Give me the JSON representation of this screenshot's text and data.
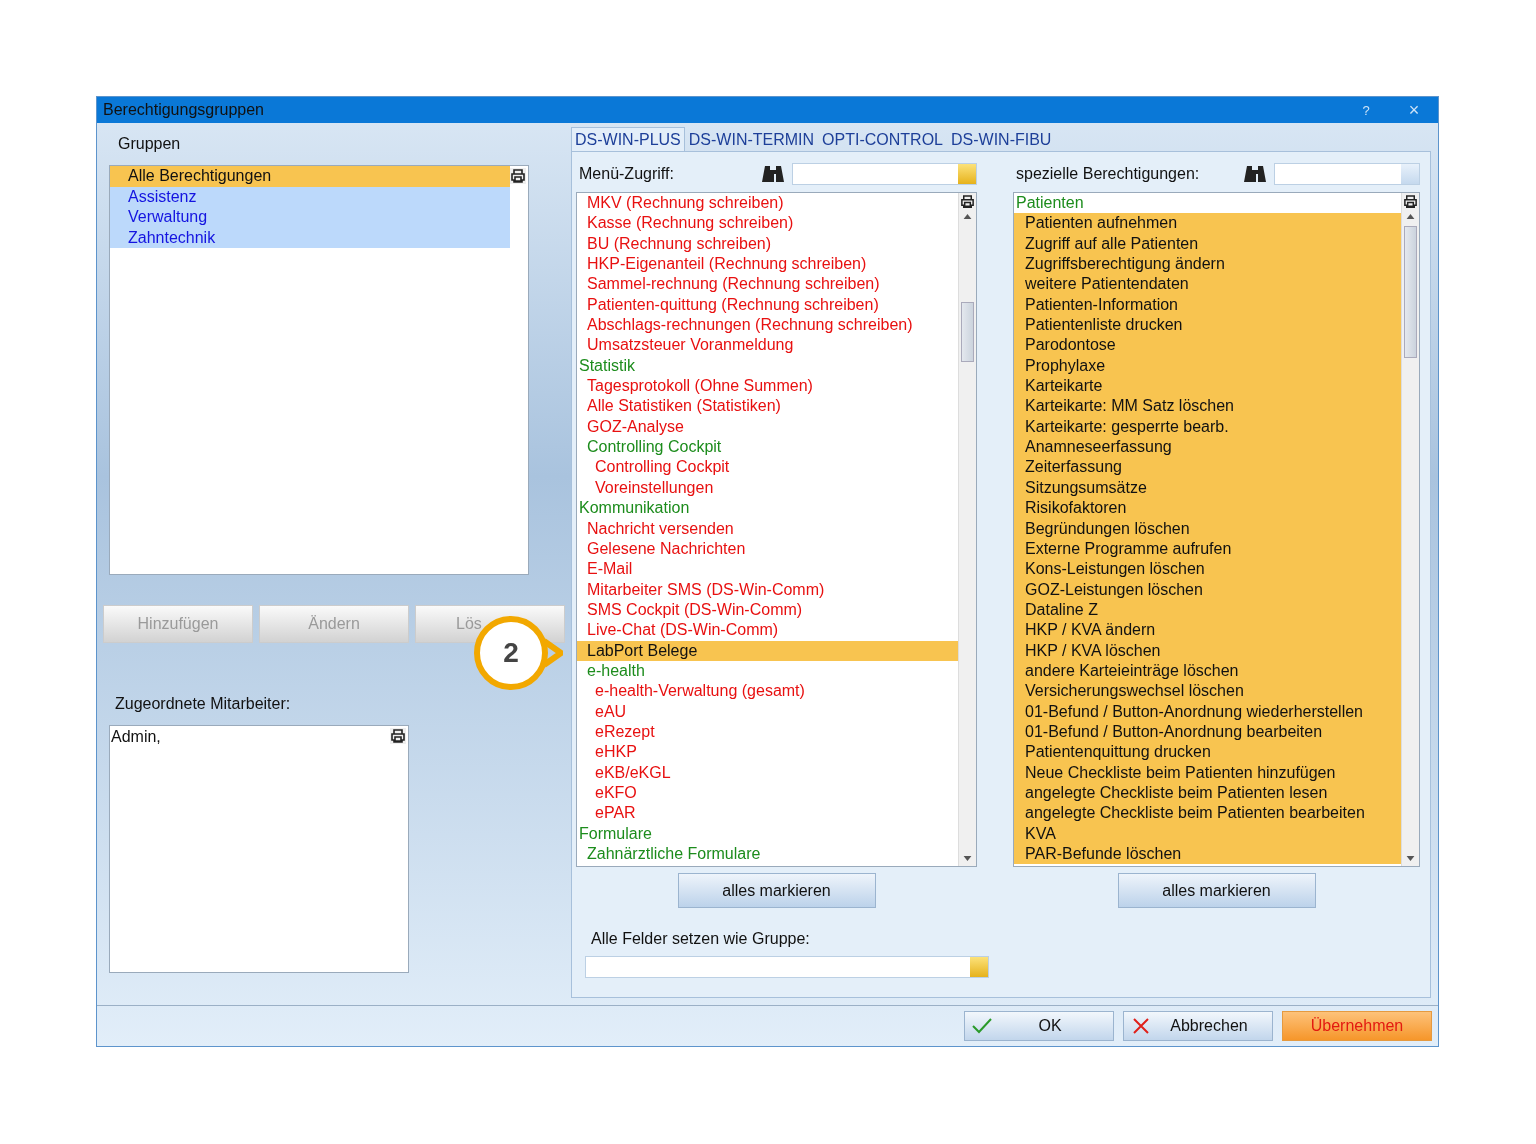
{
  "window": {
    "title": "Berechtigungsgruppen",
    "help": "?",
    "close": "×"
  },
  "groups": {
    "title": "Gruppen",
    "items": [
      {
        "label": "Alle Berechtigungen",
        "selected": true
      },
      {
        "label": "Assistenz",
        "selected": false
      },
      {
        "label": "Verwaltung",
        "selected": false
      },
      {
        "label": "Zahntechnik",
        "selected": false
      }
    ],
    "buttons": [
      {
        "label": "Hinzufügen",
        "disabled": true
      },
      {
        "label": "Ändern",
        "disabled": true
      },
      {
        "label": "Lös",
        "disabled": true
      }
    ]
  },
  "staff": {
    "label": "Zugeordnete Mitarbeiter:",
    "items": [
      "Admin,"
    ]
  },
  "tabs": [
    {
      "label": "DS-WIN-PLUS",
      "selected": true
    },
    {
      "label": "DS-WIN-TERMIN",
      "selected": false
    },
    {
      "label": "OPTI-CONTROL",
      "selected": false
    },
    {
      "label": "DS-WIN-FIBU",
      "selected": false
    }
  ],
  "menu_access": {
    "label": "Menü-Zugriff:",
    "button": "alles markieren",
    "items": [
      {
        "label": "MKV (Rechnung schreiben)",
        "kind": "item",
        "selected": false
      },
      {
        "label": "Kasse (Rechnung schreiben)",
        "kind": "item",
        "selected": false
      },
      {
        "label": "BU (Rechnung schreiben)",
        "kind": "item",
        "selected": false
      },
      {
        "label": "HKP-Eigenanteil (Rechnung schreiben)",
        "kind": "item",
        "selected": false
      },
      {
        "label": "Sammel-rechnung (Rechnung schreiben)",
        "kind": "item",
        "selected": false
      },
      {
        "label": "Patienten-quittung (Rechnung schreiben)",
        "kind": "item",
        "selected": false
      },
      {
        "label": "Abschlags-rechnungen (Rechnung schreiben)",
        "kind": "item",
        "selected": false
      },
      {
        "label": "Umsatzsteuer Voranmeldung",
        "kind": "item",
        "selected": false
      },
      {
        "label": "Statistik",
        "kind": "group",
        "selected": false,
        "children": [
          {
            "label": "Tagesprotokoll (Ohne Summen)",
            "kind": "item",
            "selected": false
          },
          {
            "label": "Alle Statistiken (Statistiken)",
            "kind": "item",
            "selected": false
          },
          {
            "label": "GOZ-Analyse",
            "kind": "item",
            "selected": false
          },
          {
            "label": "Controlling Cockpit",
            "kind": "group",
            "selected": false,
            "children": [
              {
                "label": "Controlling Cockpit",
                "kind": "item",
                "selected": false
              },
              {
                "label": "Voreinstellungen",
                "kind": "item",
                "selected": false
              }
            ]
          }
        ]
      },
      {
        "label": "Kommunikation",
        "kind": "group",
        "selected": false,
        "children": [
          {
            "label": "Nachricht versenden",
            "kind": "item",
            "selected": false
          },
          {
            "label": "Gelesene Nachrichten",
            "kind": "item",
            "selected": false
          },
          {
            "label": "E-Mail",
            "kind": "item",
            "selected": false
          },
          {
            "label": "Mitarbeiter SMS (DS-Win-Comm)",
            "kind": "item",
            "selected": false
          },
          {
            "label": "SMS Cockpit (DS-Win-Comm)",
            "kind": "item",
            "selected": false
          },
          {
            "label": "Live-Chat (DS-Win-Comm)",
            "kind": "item",
            "selected": false
          },
          {
            "label": "LabPort Belege",
            "kind": "item",
            "selected": true
          },
          {
            "label": "e-health",
            "kind": "group",
            "selected": false,
            "children": [
              {
                "label": "e-health-Verwaltung (gesamt)",
                "kind": "item",
                "selected": false
              },
              {
                "label": "eAU",
                "kind": "item",
                "selected": false
              },
              {
                "label": "eRezept",
                "kind": "item",
                "selected": false
              },
              {
                "label": "eHKP",
                "kind": "item",
                "selected": false
              },
              {
                "label": "eKB/eKGL",
                "kind": "item",
                "selected": false
              },
              {
                "label": "eKFO",
                "kind": "item",
                "selected": false
              },
              {
                "label": "ePAR",
                "kind": "item",
                "selected": false
              }
            ]
          }
        ]
      },
      {
        "label": "Formulare",
        "kind": "group",
        "selected": false,
        "children": [
          {
            "label": "Zahnärztliche Formulare",
            "kind": "group",
            "selected": false
          }
        ]
      }
    ]
  },
  "special_permissions": {
    "label": "spezielle Berechtigungen:",
    "button": "alles markieren",
    "items": [
      {
        "label": "Patienten",
        "kind": "group",
        "selected": false,
        "children": [
          {
            "label": "Patienten aufnehmen",
            "kind": "item",
            "selected": true
          },
          {
            "label": "Zugriff auf alle Patienten",
            "kind": "item",
            "selected": true
          },
          {
            "label": "Zugriffsberechtigung ändern",
            "kind": "item",
            "selected": true
          },
          {
            "label": "weitere Patientendaten",
            "kind": "item",
            "selected": true
          },
          {
            "label": "Patienten-Information",
            "kind": "item",
            "selected": true
          },
          {
            "label": "Patientenliste drucken",
            "kind": "item",
            "selected": true
          },
          {
            "label": "Parodontose",
            "kind": "item",
            "selected": true
          },
          {
            "label": "Prophylaxe",
            "kind": "item",
            "selected": true
          },
          {
            "label": "Karteikarte",
            "kind": "item",
            "selected": true
          },
          {
            "label": "Karteikarte: MM Satz löschen",
            "kind": "item",
            "selected": true
          },
          {
            "label": "Karteikarte: gesperrte bearb.",
            "kind": "item",
            "selected": true
          },
          {
            "label": "Anamneseerfassung",
            "kind": "item",
            "selected": true
          },
          {
            "label": "Zeiterfassung",
            "kind": "item",
            "selected": true
          },
          {
            "label": "Sitzungsumsätze",
            "kind": "item",
            "selected": true
          },
          {
            "label": "Risikofaktoren",
            "kind": "item",
            "selected": true
          },
          {
            "label": "Begründungen löschen",
            "kind": "item",
            "selected": true
          },
          {
            "label": "Externe Programme aufrufen",
            "kind": "item",
            "selected": true
          },
          {
            "label": "Kons-Leistungen löschen",
            "kind": "item",
            "selected": true
          },
          {
            "label": "GOZ-Leistungen löschen",
            "kind": "item",
            "selected": true
          },
          {
            "label": "Dataline Z",
            "kind": "item",
            "selected": true
          },
          {
            "label": "HKP / KVA ändern",
            "kind": "item",
            "selected": true
          },
          {
            "label": "HKP / KVA löschen",
            "kind": "item",
            "selected": true
          },
          {
            "label": "andere Karteieinträge löschen",
            "kind": "item",
            "selected": true
          },
          {
            "label": "Versicherungswechsel löschen",
            "kind": "item",
            "selected": true
          },
          {
            "label": "01-Befund / Button-Anordnung wiederherstellen",
            "kind": "item",
            "selected": true
          },
          {
            "label": "01-Befund / Button-Anordnung bearbeiten",
            "kind": "item",
            "selected": true
          },
          {
            "label": "Patientenquittung drucken",
            "kind": "item",
            "selected": true
          },
          {
            "label": "Neue Checkliste beim Patienten hinzufügen",
            "kind": "item",
            "selected": true
          },
          {
            "label": "angelegte Checkliste beim Patienten lesen",
            "kind": "item",
            "selected": true
          },
          {
            "label": "angelegte Checkliste beim Patienten bearbeiten",
            "kind": "item",
            "selected": true
          },
          {
            "label": "KVA",
            "kind": "item",
            "selected": true
          },
          {
            "label": "PAR-Befunde löschen",
            "kind": "item",
            "selected": true
          }
        ]
      }
    ]
  },
  "copy_from": {
    "label": "Alle Felder setzen wie Gruppe:"
  },
  "footer_buttons": [
    {
      "label": "OK",
      "kind": "confirm"
    },
    {
      "label": "Abbrechen",
      "kind": "cancel"
    },
    {
      "label": "Übernehmen",
      "kind": "apply"
    }
  ],
  "callout": {
    "label": "2"
  }
}
